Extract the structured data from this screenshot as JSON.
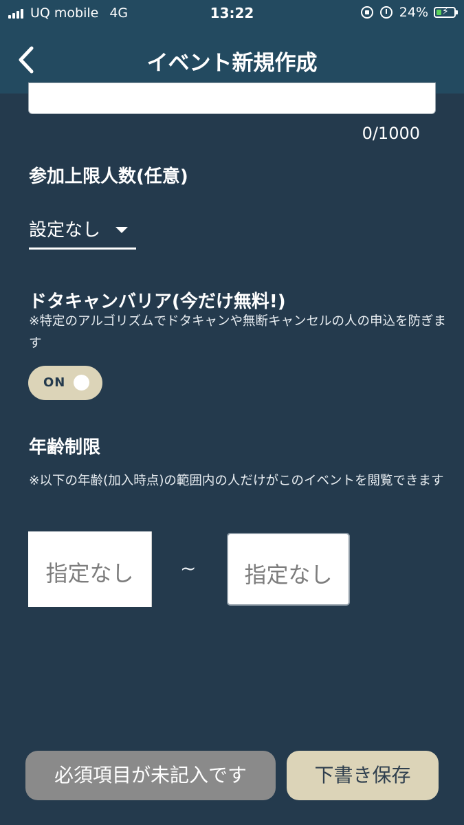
{
  "status_bar": {
    "carrier": "UQ mobile",
    "network": "4G",
    "time": "13:22",
    "battery": "24%"
  },
  "header": {
    "title": "イベント新規作成",
    "back_icon": "chevron-left-icon"
  },
  "description": {
    "char_count": "0/1000"
  },
  "capacity": {
    "title": "参加上限人数(任意)",
    "selected": "設定なし"
  },
  "barrier": {
    "title": "ドタキャンバリア(今だけ無料!)",
    "note": "※特定のアルゴリズムでドタキャンや無断キャンセルの人の申込を防ぎます",
    "toggle_label": "ON",
    "enabled": true
  },
  "age": {
    "title": "年齢制限",
    "note": "※以下の年齢(加入時点)の範囲内の人だけがこのイベントを閲覧できます",
    "min_placeholder": "指定なし",
    "separator": "~",
    "max_placeholder": "指定なし"
  },
  "footer": {
    "required_button": "必須項目が未記入です",
    "draft_button": "下書き保存"
  },
  "colors": {
    "background": "#243a4d",
    "header": "#234a60",
    "accent": "#dcd4b8",
    "disabled": "#8a8a8a"
  }
}
